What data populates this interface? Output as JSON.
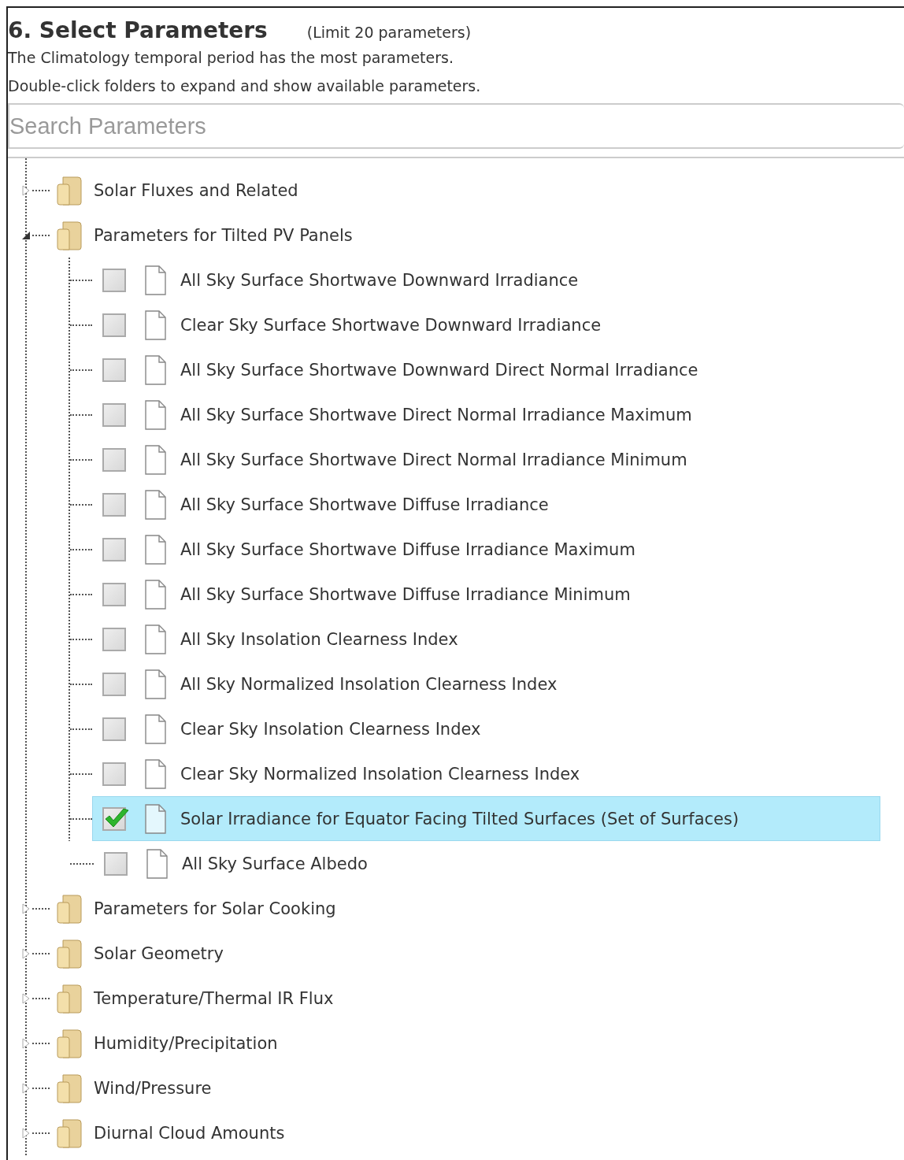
{
  "header": {
    "title": "6. Select Parameters",
    "limit": "(Limit 20 parameters)",
    "notes": [
      "The Climatology temporal period has the most parameters.",
      "Double-click folders to expand and show available parameters."
    ]
  },
  "search": {
    "placeholder": "Search Parameters"
  },
  "tree": [
    {
      "label": "Solar Fluxes and Related",
      "expanded": false
    },
    {
      "label": "Parameters for Tilted PV Panels",
      "expanded": true,
      "children": [
        {
          "label": "All Sky Surface Shortwave Downward Irradiance",
          "checked": false,
          "selected": false
        },
        {
          "label": "Clear Sky Surface Shortwave Downward Irradiance",
          "checked": false,
          "selected": false
        },
        {
          "label": "All Sky Surface Shortwave Downward Direct Normal Irradiance",
          "checked": false,
          "selected": false
        },
        {
          "label": "All Sky Surface Shortwave Direct Normal Irradiance Maximum",
          "checked": false,
          "selected": false
        },
        {
          "label": "All Sky Surface Shortwave Direct Normal Irradiance Minimum",
          "checked": false,
          "selected": false
        },
        {
          "label": "All Sky Surface Shortwave Diffuse Irradiance",
          "checked": false,
          "selected": false
        },
        {
          "label": "All Sky Surface Shortwave Diffuse Irradiance Maximum",
          "checked": false,
          "selected": false
        },
        {
          "label": "All Sky Surface Shortwave Diffuse Irradiance Minimum",
          "checked": false,
          "selected": false
        },
        {
          "label": "All Sky Insolation Clearness Index",
          "checked": false,
          "selected": false
        },
        {
          "label": "All Sky Normalized Insolation Clearness Index",
          "checked": false,
          "selected": false
        },
        {
          "label": "Clear Sky Insolation Clearness Index",
          "checked": false,
          "selected": false
        },
        {
          "label": "Clear Sky Normalized Insolation Clearness Index",
          "checked": false,
          "selected": false
        },
        {
          "label": "Solar Irradiance for Equator Facing Tilted Surfaces (Set of Surfaces)",
          "checked": true,
          "selected": true
        },
        {
          "label": "All Sky Surface Albedo",
          "checked": false,
          "selected": false
        }
      ]
    },
    {
      "label": "Parameters for Solar Cooking",
      "expanded": false
    },
    {
      "label": "Solar Geometry",
      "expanded": false
    },
    {
      "label": "Temperature/Thermal IR Flux",
      "expanded": false
    },
    {
      "label": "Humidity/Precipitation",
      "expanded": false
    },
    {
      "label": "Wind/Pressure",
      "expanded": false
    },
    {
      "label": "Diurnal Cloud Amounts",
      "expanded": false
    }
  ]
}
